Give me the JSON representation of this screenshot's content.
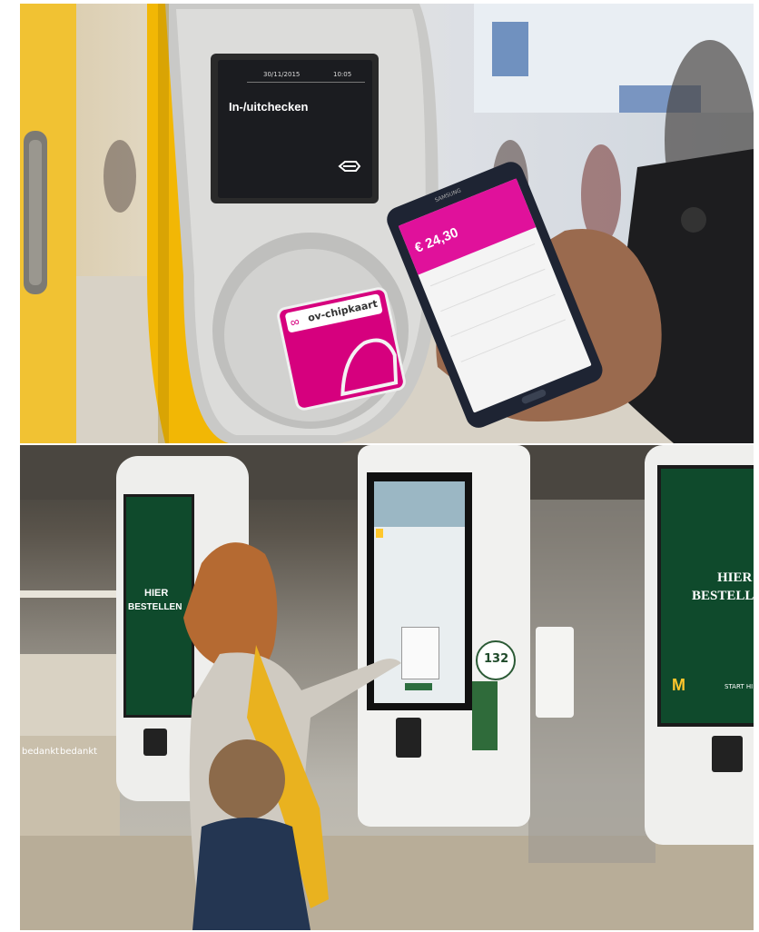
{
  "top_photo": {
    "reader_screen": {
      "date": "30/11/2015",
      "time": "10:05",
      "message": "In-/uitchecken"
    },
    "card_logo_text": "ov-chipkaart",
    "phone_brand": "SAMSUNG",
    "phone_app": {
      "balance": "€ 24,30",
      "accent_color": "#e0119b"
    },
    "colors": {
      "reader_yellow": "#f2b705",
      "card_magenta": "#d6007e"
    }
  },
  "bottom_photo": {
    "kiosk_left": {
      "title_line1": "HIER",
      "title_line2": "BESTELLEN"
    },
    "kiosk_right": {
      "title_line1": "HIER",
      "title_line2": "BESTELLEN",
      "start_label": "START HI"
    },
    "kiosk_center": {
      "badge_number": "132"
    },
    "counter_labels": [
      "bedankt",
      "bedankt"
    ],
    "colors": {
      "kiosk_green": "#0f4a2c",
      "mcd_yellow": "#ffc72c",
      "scarf_yellow": "#e9b21f"
    }
  }
}
